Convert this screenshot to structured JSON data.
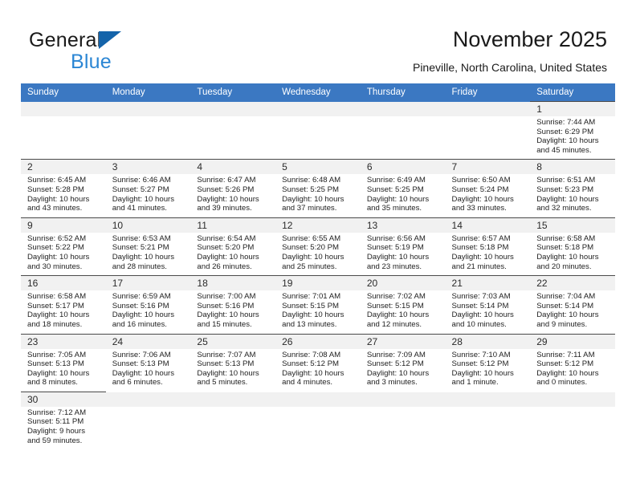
{
  "brand": {
    "name_part1": "General",
    "name_part2": "Blue",
    "triangle_color": "#1464aa",
    "blue_color": "#2b86d4"
  },
  "header": {
    "title": "November 2025",
    "subtitle": "Pineville, North Carolina, United States",
    "header_bg_color": "#3b78c2"
  },
  "calendar": {
    "weekdays": [
      "Sunday",
      "Monday",
      "Tuesday",
      "Wednesday",
      "Thursday",
      "Friday",
      "Saturday"
    ],
    "weeks": [
      [
        {
          "day": "",
          "lines": []
        },
        {
          "day": "",
          "lines": []
        },
        {
          "day": "",
          "lines": []
        },
        {
          "day": "",
          "lines": []
        },
        {
          "day": "",
          "lines": []
        },
        {
          "day": "",
          "lines": []
        },
        {
          "day": "1",
          "lines": [
            "Sunrise: 7:44 AM",
            "Sunset: 6:29 PM",
            "Daylight: 10 hours",
            "and 45 minutes."
          ]
        }
      ],
      [
        {
          "day": "2",
          "lines": [
            "Sunrise: 6:45 AM",
            "Sunset: 5:28 PM",
            "Daylight: 10 hours",
            "and 43 minutes."
          ]
        },
        {
          "day": "3",
          "lines": [
            "Sunrise: 6:46 AM",
            "Sunset: 5:27 PM",
            "Daylight: 10 hours",
            "and 41 minutes."
          ]
        },
        {
          "day": "4",
          "lines": [
            "Sunrise: 6:47 AM",
            "Sunset: 5:26 PM",
            "Daylight: 10 hours",
            "and 39 minutes."
          ]
        },
        {
          "day": "5",
          "lines": [
            "Sunrise: 6:48 AM",
            "Sunset: 5:25 PM",
            "Daylight: 10 hours",
            "and 37 minutes."
          ]
        },
        {
          "day": "6",
          "lines": [
            "Sunrise: 6:49 AM",
            "Sunset: 5:25 PM",
            "Daylight: 10 hours",
            "and 35 minutes."
          ]
        },
        {
          "day": "7",
          "lines": [
            "Sunrise: 6:50 AM",
            "Sunset: 5:24 PM",
            "Daylight: 10 hours",
            "and 33 minutes."
          ]
        },
        {
          "day": "8",
          "lines": [
            "Sunrise: 6:51 AM",
            "Sunset: 5:23 PM",
            "Daylight: 10 hours",
            "and 32 minutes."
          ]
        }
      ],
      [
        {
          "day": "9",
          "lines": [
            "Sunrise: 6:52 AM",
            "Sunset: 5:22 PM",
            "Daylight: 10 hours",
            "and 30 minutes."
          ]
        },
        {
          "day": "10",
          "lines": [
            "Sunrise: 6:53 AM",
            "Sunset: 5:21 PM",
            "Daylight: 10 hours",
            "and 28 minutes."
          ]
        },
        {
          "day": "11",
          "lines": [
            "Sunrise: 6:54 AM",
            "Sunset: 5:20 PM",
            "Daylight: 10 hours",
            "and 26 minutes."
          ]
        },
        {
          "day": "12",
          "lines": [
            "Sunrise: 6:55 AM",
            "Sunset: 5:20 PM",
            "Daylight: 10 hours",
            "and 25 minutes."
          ]
        },
        {
          "day": "13",
          "lines": [
            "Sunrise: 6:56 AM",
            "Sunset: 5:19 PM",
            "Daylight: 10 hours",
            "and 23 minutes."
          ]
        },
        {
          "day": "14",
          "lines": [
            "Sunrise: 6:57 AM",
            "Sunset: 5:18 PM",
            "Daylight: 10 hours",
            "and 21 minutes."
          ]
        },
        {
          "day": "15",
          "lines": [
            "Sunrise: 6:58 AM",
            "Sunset: 5:18 PM",
            "Daylight: 10 hours",
            "and 20 minutes."
          ]
        }
      ],
      [
        {
          "day": "16",
          "lines": [
            "Sunrise: 6:58 AM",
            "Sunset: 5:17 PM",
            "Daylight: 10 hours",
            "and 18 minutes."
          ]
        },
        {
          "day": "17",
          "lines": [
            "Sunrise: 6:59 AM",
            "Sunset: 5:16 PM",
            "Daylight: 10 hours",
            "and 16 minutes."
          ]
        },
        {
          "day": "18",
          "lines": [
            "Sunrise: 7:00 AM",
            "Sunset: 5:16 PM",
            "Daylight: 10 hours",
            "and 15 minutes."
          ]
        },
        {
          "day": "19",
          "lines": [
            "Sunrise: 7:01 AM",
            "Sunset: 5:15 PM",
            "Daylight: 10 hours",
            "and 13 minutes."
          ]
        },
        {
          "day": "20",
          "lines": [
            "Sunrise: 7:02 AM",
            "Sunset: 5:15 PM",
            "Daylight: 10 hours",
            "and 12 minutes."
          ]
        },
        {
          "day": "21",
          "lines": [
            "Sunrise: 7:03 AM",
            "Sunset: 5:14 PM",
            "Daylight: 10 hours",
            "and 10 minutes."
          ]
        },
        {
          "day": "22",
          "lines": [
            "Sunrise: 7:04 AM",
            "Sunset: 5:14 PM",
            "Daylight: 10 hours",
            "and 9 minutes."
          ]
        }
      ],
      [
        {
          "day": "23",
          "lines": [
            "Sunrise: 7:05 AM",
            "Sunset: 5:13 PM",
            "Daylight: 10 hours",
            "and 8 minutes."
          ]
        },
        {
          "day": "24",
          "lines": [
            "Sunrise: 7:06 AM",
            "Sunset: 5:13 PM",
            "Daylight: 10 hours",
            "and 6 minutes."
          ]
        },
        {
          "day": "25",
          "lines": [
            "Sunrise: 7:07 AM",
            "Sunset: 5:13 PM",
            "Daylight: 10 hours",
            "and 5 minutes."
          ]
        },
        {
          "day": "26",
          "lines": [
            "Sunrise: 7:08 AM",
            "Sunset: 5:12 PM",
            "Daylight: 10 hours",
            "and 4 minutes."
          ]
        },
        {
          "day": "27",
          "lines": [
            "Sunrise: 7:09 AM",
            "Sunset: 5:12 PM",
            "Daylight: 10 hours",
            "and 3 minutes."
          ]
        },
        {
          "day": "28",
          "lines": [
            "Sunrise: 7:10 AM",
            "Sunset: 5:12 PM",
            "Daylight: 10 hours",
            "and 1 minute."
          ]
        },
        {
          "day": "29",
          "lines": [
            "Sunrise: 7:11 AM",
            "Sunset: 5:12 PM",
            "Daylight: 10 hours",
            "and 0 minutes."
          ]
        }
      ],
      [
        {
          "day": "30",
          "lines": [
            "Sunrise: 7:12 AM",
            "Sunset: 5:11 PM",
            "Daylight: 9 hours",
            "and 59 minutes."
          ]
        },
        {
          "day": "",
          "lines": []
        },
        {
          "day": "",
          "lines": []
        },
        {
          "day": "",
          "lines": []
        },
        {
          "day": "",
          "lines": []
        },
        {
          "day": "",
          "lines": []
        },
        {
          "day": "",
          "lines": []
        }
      ]
    ]
  }
}
